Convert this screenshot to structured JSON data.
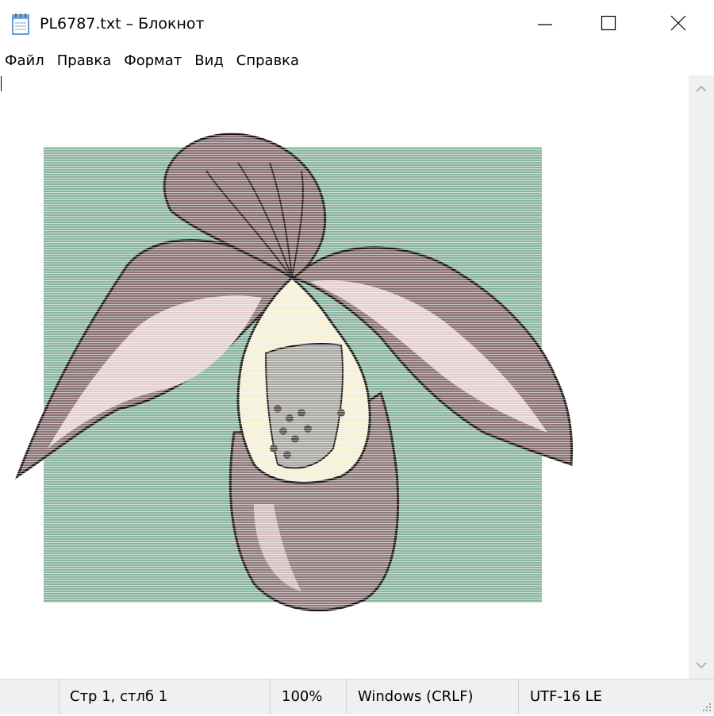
{
  "window": {
    "title": "PL6787.txt – Блокнот",
    "icon": "notepad-icon",
    "controls": [
      "minimize-icon",
      "maximize-icon",
      "close-icon"
    ]
  },
  "menu": {
    "items": [
      "Файл",
      "Правка",
      "Формат",
      "Вид",
      "Справка"
    ]
  },
  "editor": {
    "content_description_icon": "orchid-ascii-art",
    "colors": {
      "background_square": "#8bb5a0",
      "petal": "#8a7274",
      "petal_light": "#e4cfcf",
      "lip": "#8f7b7d",
      "column": "#f3f0d6",
      "outline": "#1a1414"
    }
  },
  "scrollbar": {
    "up_icon": "chevron-up-icon",
    "down_icon": "chevron-down-icon"
  },
  "status": {
    "position": "Стр 1, стлб 1",
    "zoom": "100%",
    "line_ending": "Windows (CRLF)",
    "encoding": "UTF-16 LE"
  }
}
